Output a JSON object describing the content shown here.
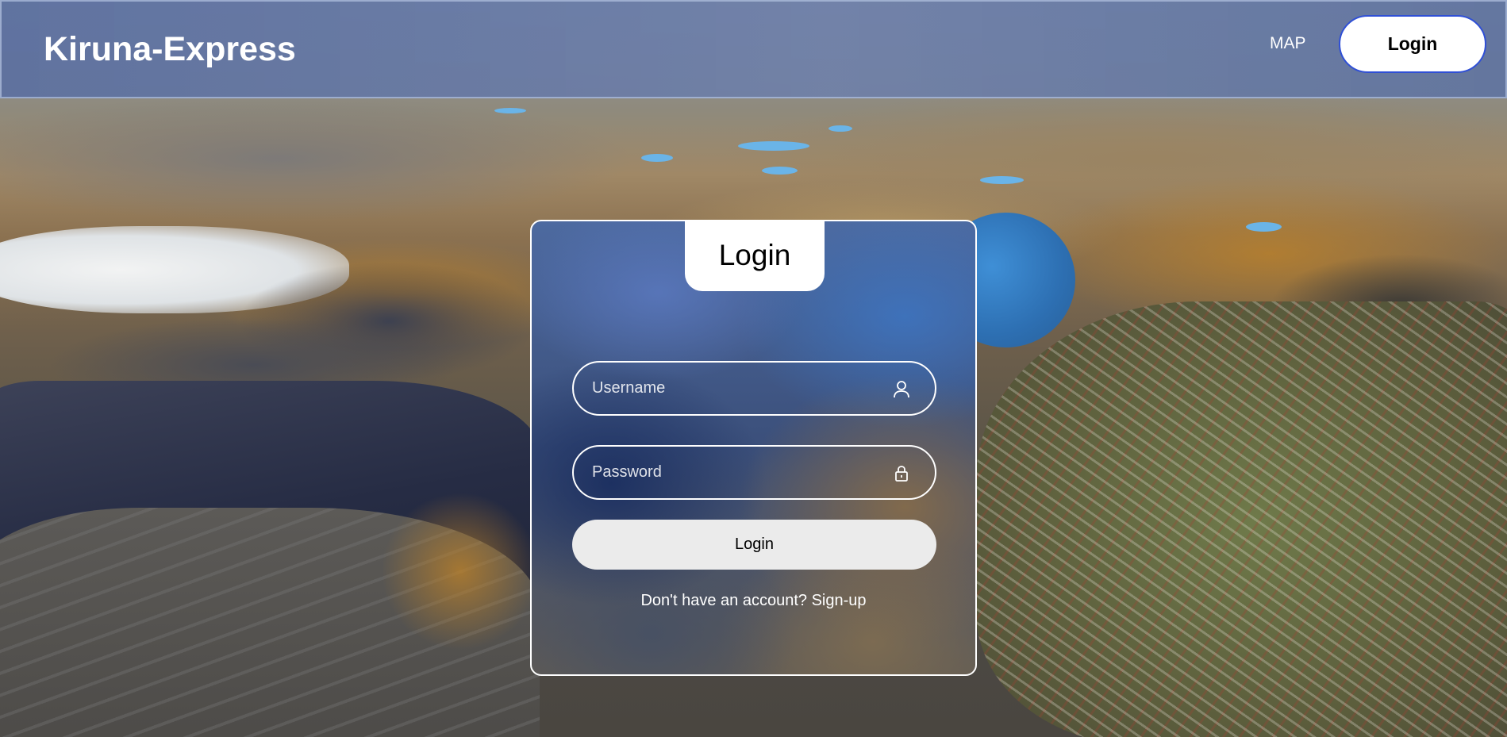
{
  "header": {
    "brand": "Kiruna-Express",
    "nav": {
      "map_label": "MAP",
      "login_label": "Login"
    },
    "accent_color": "#2f4fd6"
  },
  "login_card": {
    "title": "Login",
    "username": {
      "placeholder": "Username",
      "value": "",
      "icon": "user-icon"
    },
    "password": {
      "placeholder": "Password",
      "value": "",
      "icon": "lock-icon"
    },
    "submit_label": "Login",
    "signup_prompt": "Don't have an account?",
    "signup_link": "Sign-up"
  }
}
